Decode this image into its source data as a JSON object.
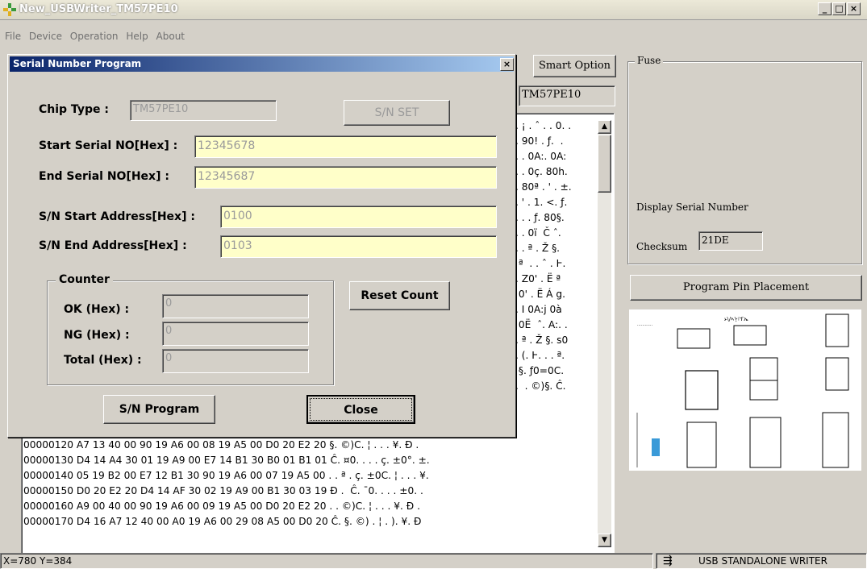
{
  "window": {
    "title": "New_USBWriter_TM57PE10",
    "minimize": "_",
    "maximize": "□",
    "close": "×"
  },
  "menu": {
    "file": "File",
    "device": "Device",
    "operation": "Operation",
    "help": "Help",
    "about": "About"
  },
  "main": {
    "smart_option": "Smart Option",
    "chip_display": "TM57PE10",
    "hex_partial": [
      ". ¡ . ˆ . . 0. .",
      ". 90! . ƒ.  .",
      ". . 0A:. 0A:",
      ". . 0ç. 80h.",
      ". 80ª . ' . ±.",
      ". ' . 1. <. ƒ.",
      ". . . ƒ. 80§.",
      ". . 0ï  Č ˆ.",
      ". . ª . Ž §.",
      " ª  . . ˆ . Ͱ.",
      ". Z0' . Ë ª",
      " 0' . Ë Á g.",
      ". I 0A:j 0à",
      " 0Ë  ˆ. A:. .",
      ". ª . Ž §. s0",
      ". (. Ͱ. . . ª.",
      " §. ƒ0=0Ⅽ.",
      ".  . ©)§. Ĉ."
    ],
    "hex_rows": [
      "00000120 A7 13 40 00 90 19 A6 00 08 19 A5 00 D0 20 E2 20 §. ©)Ⅽ. ¦ . . . ¥. Ð .",
      "00000130 D4 14 A4 30 01 19 A9 00 E7 14 B1 30 B0 01 B1 01 Ĉ. ¤0. . . . ç. ±0°. ±.",
      "00000140 05 19 B2 00 E7 12 B1 30 90 19 A6 00 07 19 A5 00 . . ª . ç. ±0Ⅽ. ¦ . . . ¥.",
      "00000150 D0 20 E2 20 D4 14 AF 30 02 19 A9 00 B1 30 03 19 Ð .  Ĉ. ¯0. . . . ±0. .",
      "00000160 A9 00 40 00 90 19 A6 00 09 19 A5 00 D0 20 E2 20 . . ©)Ⅽ. ¦ . . . ¥. Ð .",
      "00000170 D4 16 A7 12 40 00 A0 19 A6 00 29 08 A5 00 D0 20 Ĉ. §. ©) . ¦ . ). ¥. Ð"
    ]
  },
  "fuse": {
    "legend": "Fuse",
    "display_serial": "Display Serial Number",
    "checksum_label": "Checksum",
    "checksum_value": "21DE",
    "program_pin": "Program Pin Placement"
  },
  "dialog": {
    "title": "Serial Number Program",
    "close_x": "×",
    "chip_type_label": "Chip Type :",
    "chip_type_value": "TM57PE10",
    "sn_set": "S/N SET",
    "start_serial_label": "Start Serial NO[Hex] :",
    "start_serial_value": "12345678",
    "end_serial_label": "End Serial NO[Hex] :",
    "end_serial_value": "12345687",
    "sn_start_addr_label": "S/N Start Address[Hex] :",
    "sn_start_addr_value": "0100",
    "sn_end_addr_label": "S/N End Address[Hex] :",
    "sn_end_addr_value": "0103",
    "counter_legend": "Counter",
    "ok_label": "OK (Hex) :",
    "ok_value": "0",
    "ng_label": "NG (Hex) :",
    "ng_value": "0",
    "total_label": "Total (Hex) :",
    "total_value": "0",
    "reset_count": "Reset Count",
    "sn_program": "S/N Program",
    "close": "Close"
  },
  "status": {
    "coords": "X=780 Y=384",
    "mode": "USB STANDALONE WRITER"
  }
}
